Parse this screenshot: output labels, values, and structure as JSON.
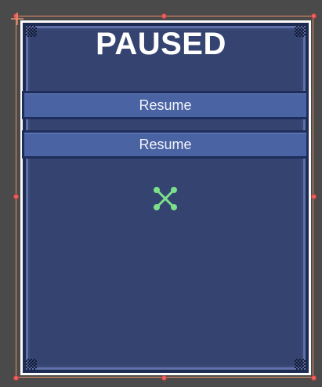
{
  "panel": {
    "title": "PAUSED",
    "buttons": [
      {
        "label": "Resume"
      },
      {
        "label": "Resume"
      }
    ]
  },
  "colors": {
    "background": "#4a4a4a",
    "panel_fill": "#354370",
    "button_face": "#4a63a3",
    "selection_outline": "#e8906a",
    "handle": "#ec6060",
    "pivot_icon": "#7be08a"
  },
  "icons": {
    "pivot": "anchor-pivot-icon",
    "move": "move-tool-crosshair-icon"
  }
}
